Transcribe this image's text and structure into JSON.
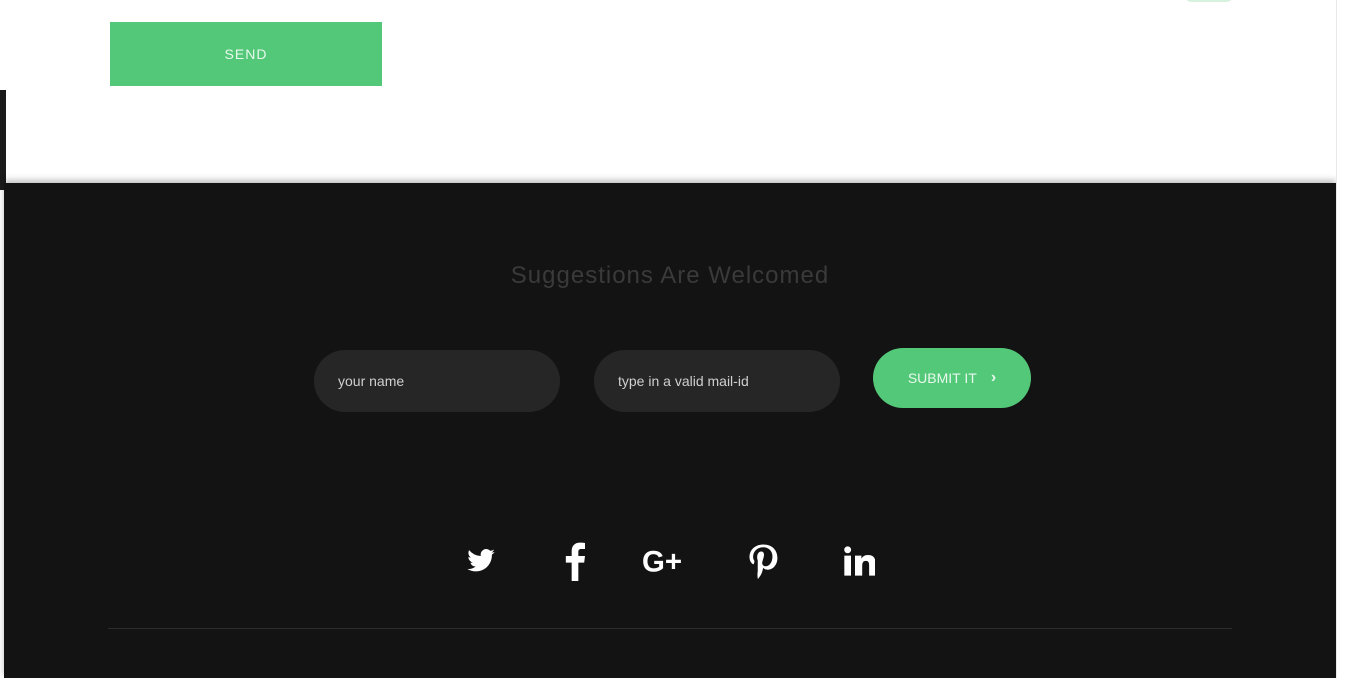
{
  "top_section": {
    "send_button_label": "SEND"
  },
  "footer": {
    "title": "Suggestions Are Welcomed",
    "form": {
      "name_placeholder": "your name",
      "email_placeholder": "type in a valid mail-id",
      "submit_label": "SUBMIT IT"
    },
    "social_icons": [
      {
        "icon": "twitter-icon"
      },
      {
        "icon": "facebook-icon"
      },
      {
        "icon": "google-plus-icon"
      },
      {
        "icon": "pinterest-icon"
      },
      {
        "icon": "linkedin-icon"
      }
    ],
    "copyright": ""
  },
  "colors": {
    "accent_green": "#52c878",
    "footer_bg": "#131313",
    "field_bg": "#262626"
  }
}
